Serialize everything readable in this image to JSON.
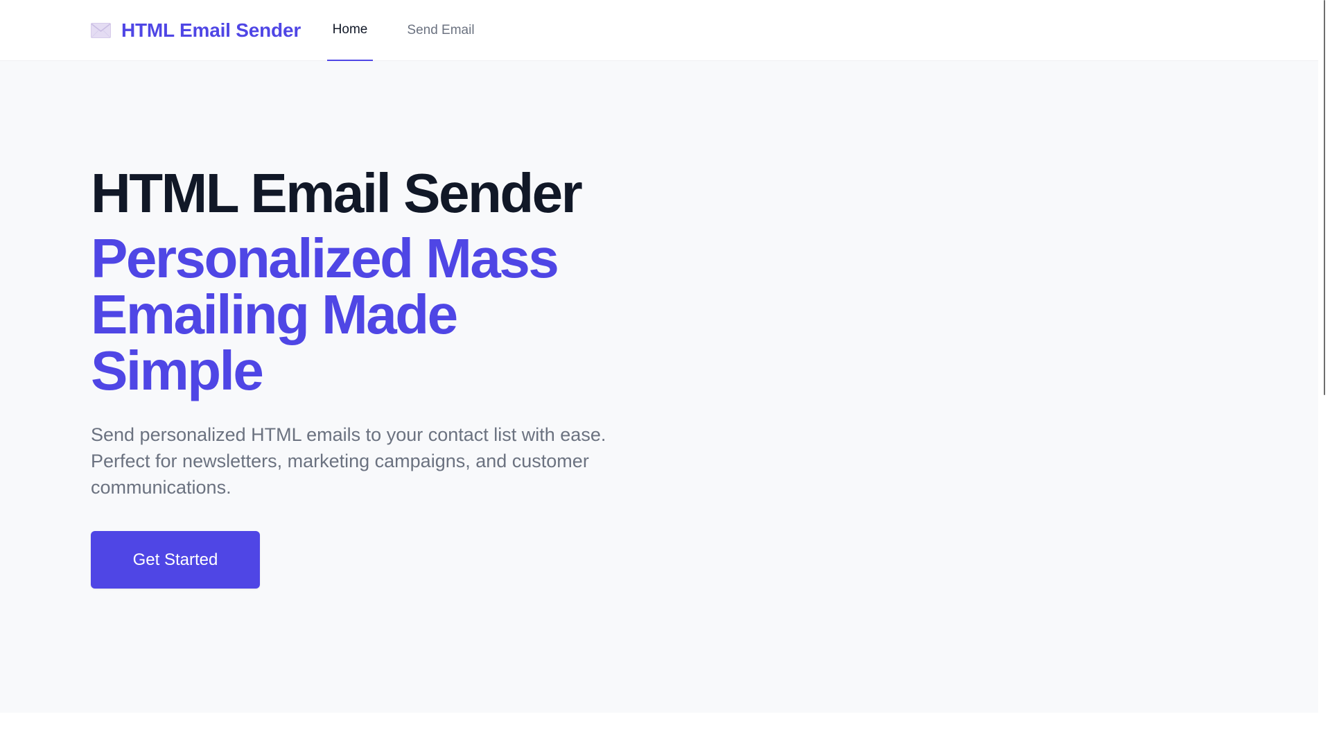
{
  "nav": {
    "brand": "HTML Email Sender",
    "brand_icon": "envelope-icon",
    "tabs": [
      {
        "label": "Home",
        "active": true
      },
      {
        "label": "Send Email",
        "active": false
      }
    ]
  },
  "hero": {
    "title": "HTML Email Sender",
    "subtitle": "Personalized Mass Emailing Made Simple",
    "description": "Send personalized HTML emails to your contact list with ease. Perfect for newsletters, marketing campaigns, and customer communications.",
    "cta_label": "Get Started"
  },
  "colors": {
    "accent": "#4f46e5",
    "heading": "#111827",
    "muted": "#6b7280",
    "hero_bg": "#f8f9fb"
  }
}
